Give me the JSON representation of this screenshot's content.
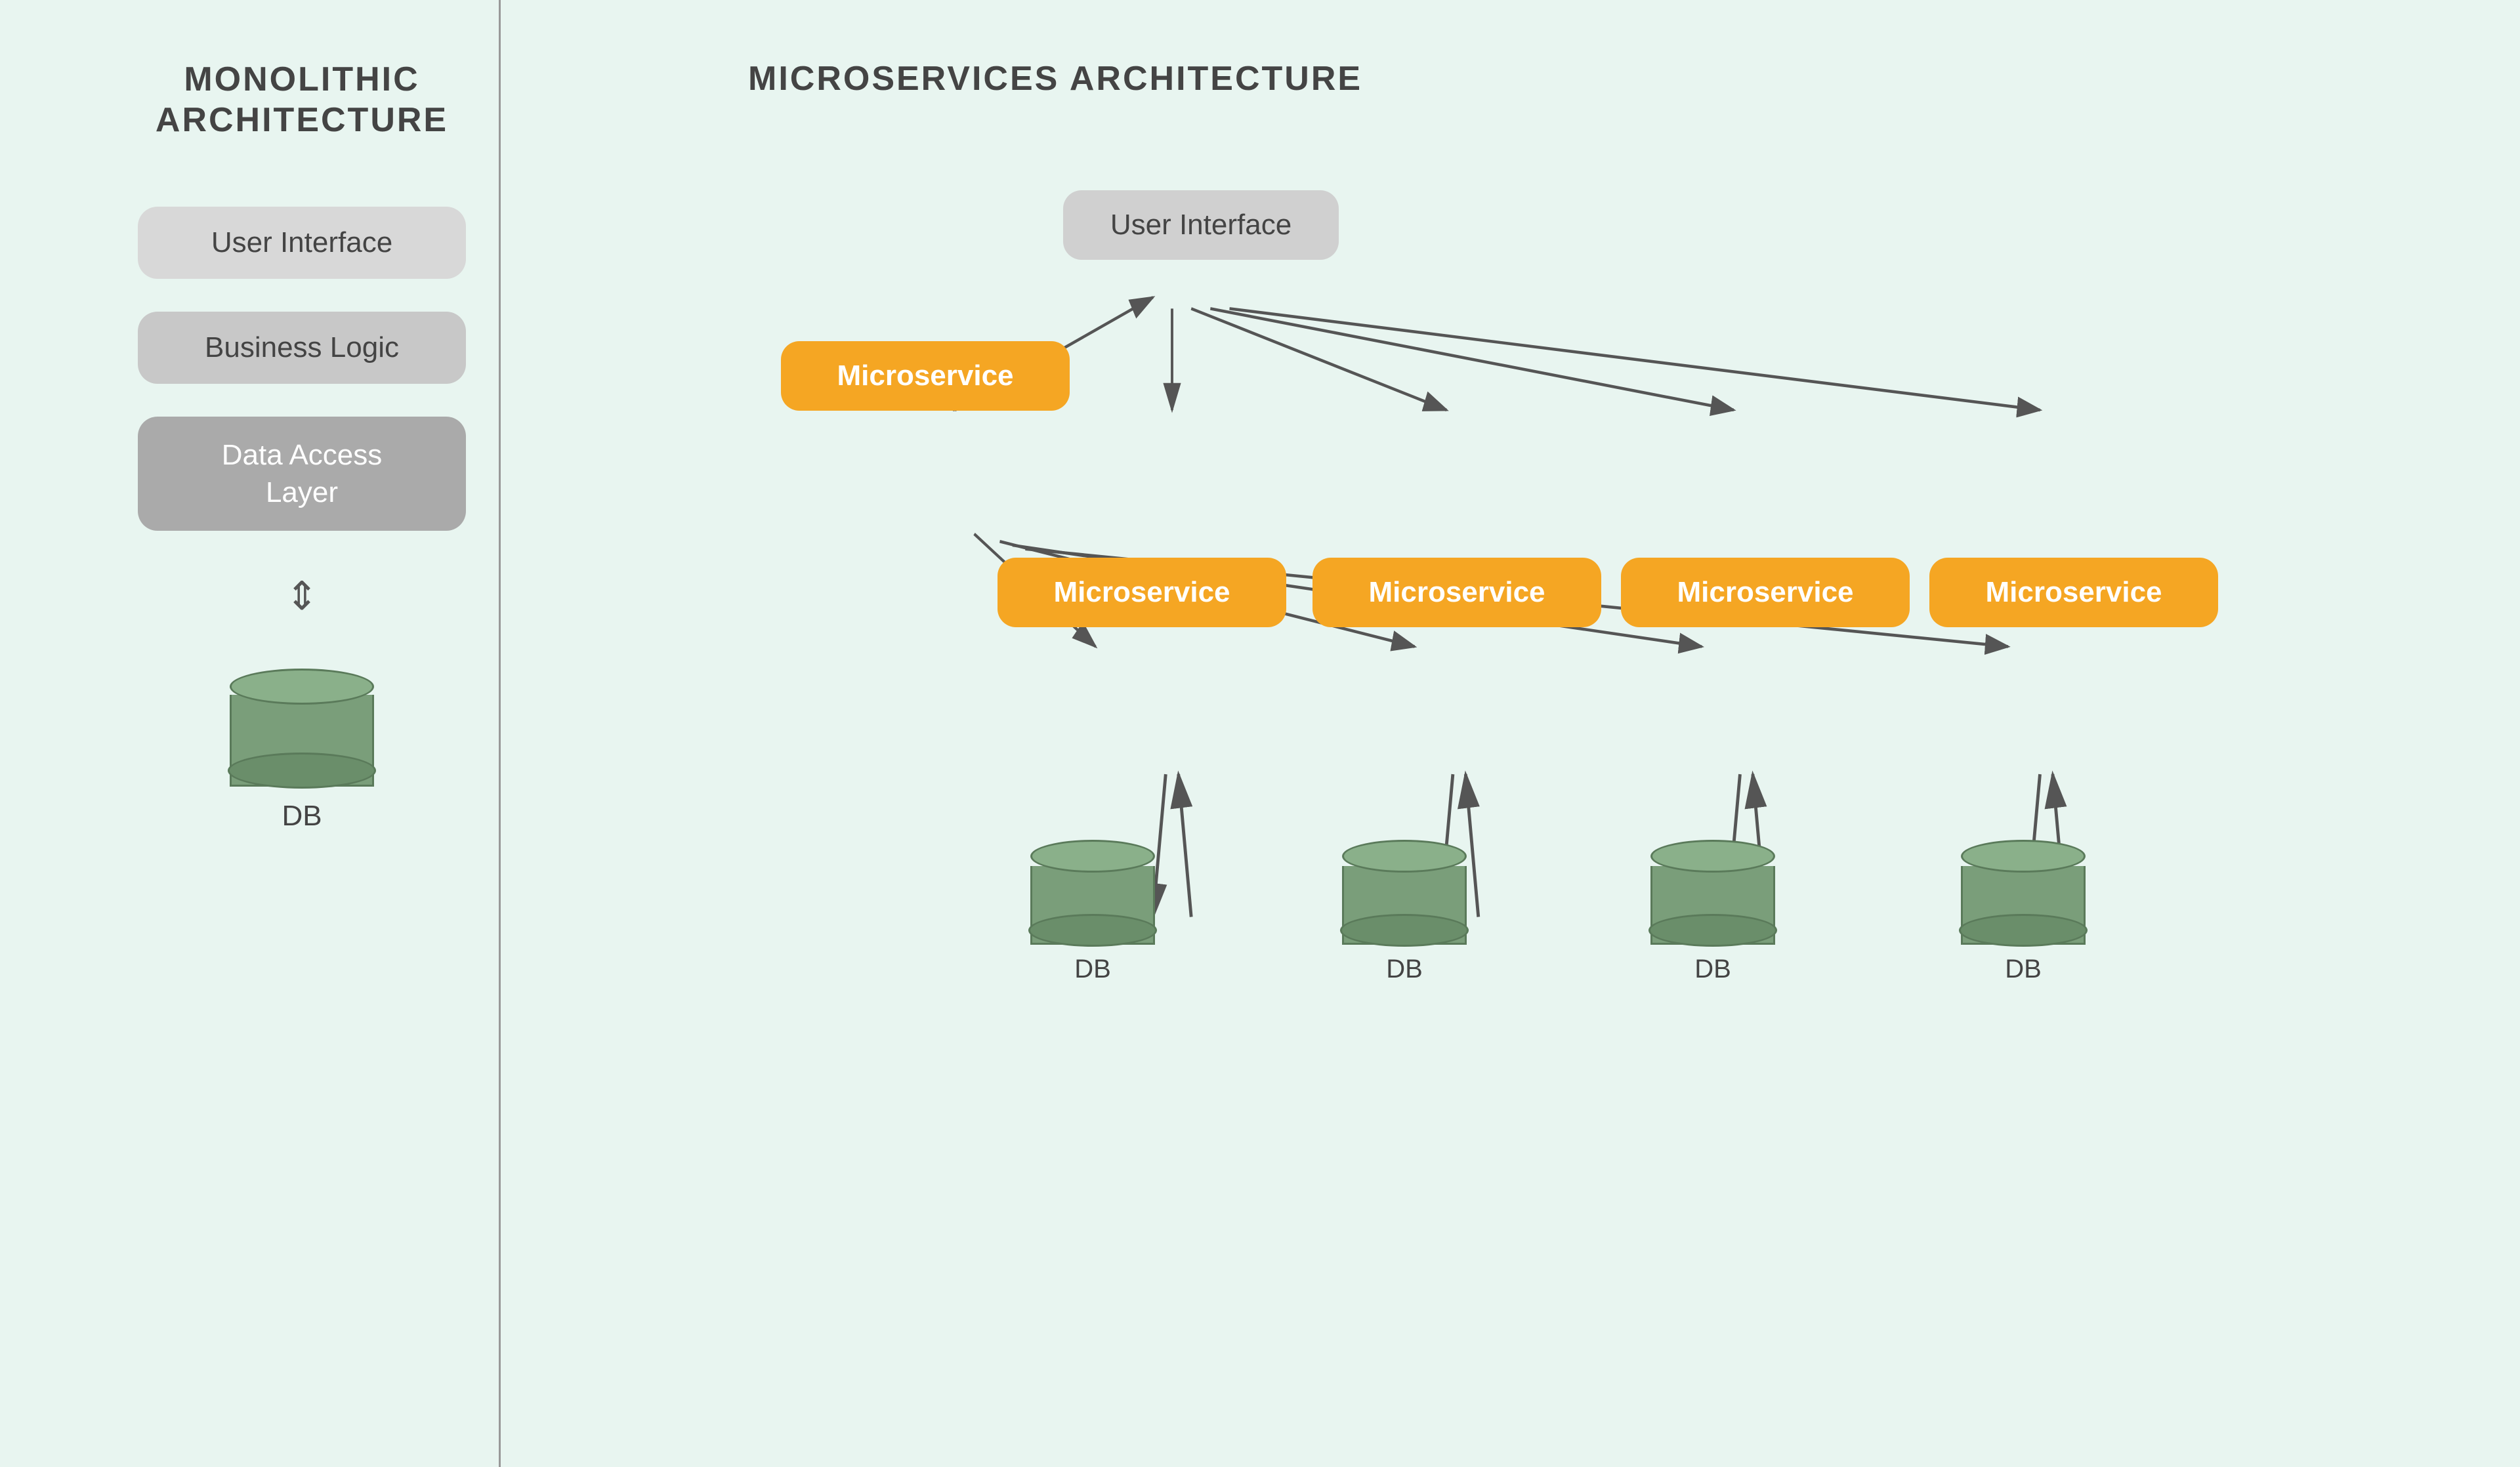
{
  "monolithic": {
    "title": "MONOLITHIC\nARCHITECTURE",
    "ui_label": "User Interface",
    "bl_label": "Business Logic",
    "dal_label": "Data Access\nLayer",
    "db_label": "DB",
    "arrow_symbol": "⇕"
  },
  "microservices": {
    "title": "MICROSERVICES ARCHITECTURE",
    "ui_label": "User Interface",
    "ms_top_label": "Microservice",
    "ms_labels": [
      "Microservice",
      "Microservice",
      "Microservice",
      "Microservice"
    ],
    "db_labels": [
      "DB",
      "DB",
      "DB",
      "DB"
    ]
  },
  "colors": {
    "background": "#e8f5f0",
    "orange": "#f5a623",
    "gray_light": "#d0d0d0",
    "gray_mid": "#c0c0c0",
    "gray_dark": "#aaaaaa",
    "db_green": "#7a9e7a",
    "text_dark": "#444444",
    "text_white": "#ffffff"
  }
}
